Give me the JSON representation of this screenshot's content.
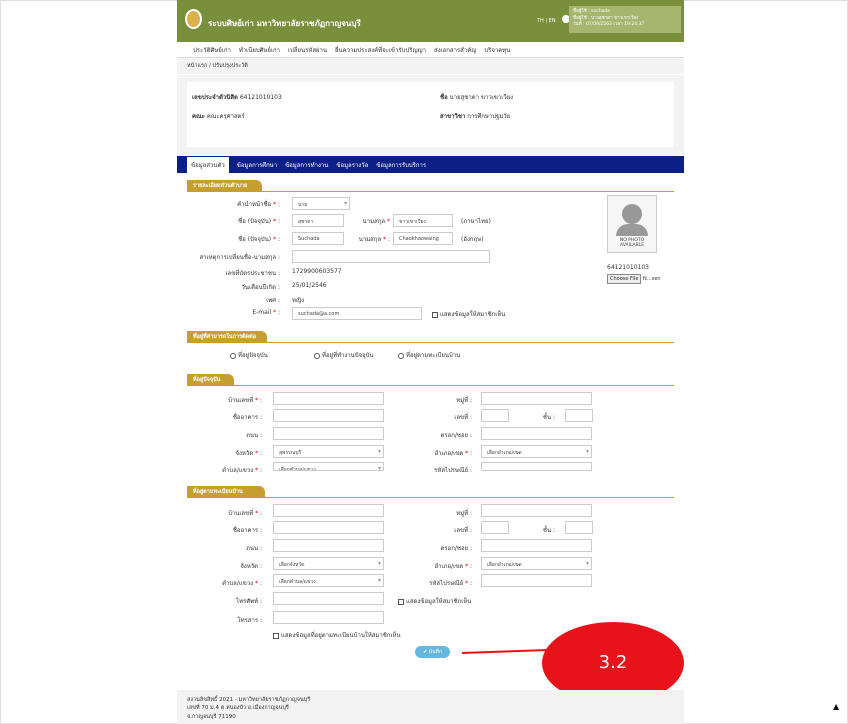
{
  "header": {
    "site_name": "ระบบศิษย์เก่า มหาวิทยาลัยราชภัฏกาญจนบุรี",
    "lang": "TH | EN",
    "user_line1": "ชื่อผู้ใช้ : suchada",
    "user_line2": "ชื่อผู้ใช้ : นางสุชาดา ขาวเขาเวียง",
    "user_line3": "วันที่ : 07/09/2563 เวลา 19:24:37"
  },
  "nav": [
    "ประวัติศิษย์เก่า",
    "ทำเนียบศิษย์เก่า",
    "เปลี่ยนรหัสผ่าน",
    "ยื่นความประสงค์ที่จะเข้ารับปริญญา",
    "ส่งเอกสารสำคัญ",
    "บริจาคทุน"
  ],
  "breadcrumb": "หน้าแรก / ปรับปรุงประวัติ",
  "info": {
    "student_id_label": "เลขประจำตัวนิสิต",
    "student_id": "64121010103",
    "name_label": "ชื่อ",
    "name": "นายสุชาดา ขาวเขาเวียง",
    "faculty_label": "คณะ",
    "faculty": "คณะครุศาสตร์",
    "major_label": "สาขาวิชา",
    "major": "การศึกษาปฐมวัย"
  },
  "tabs": [
    "ข้อมูลส่วนตัว",
    "ข้อมูลการศึกษา",
    "ข้อมูลการทำงาน",
    "ข้อมูลรางวัล",
    "ข้อมูลการรับบริการ"
  ],
  "personal": {
    "section": "รายละเอียดส่วนตัวบาย",
    "title_label": "คำนำหน้าชื่อ",
    "title_value": "นาย",
    "fname_th_label": "ชื่อ (ปัจจุบัน)",
    "fname_th": "สุชาดา",
    "lname_th_label": "นามสกุล",
    "lname_th": "ขาวเขาเวียง",
    "th_note": "(ภาษาไทย)",
    "fname_en_label": "ชื่อ (ปัจจุบัน)",
    "fname_en": "Suchada",
    "lname_en_label": "นามสกุล",
    "lname_en": "Chaokhaowaing",
    "en_note": "(อังกฤษ)",
    "reason_label": "สาเหตุการเปลี่ยนชื่อ-นามสกุล :",
    "idcard_label": "เลขที่บัตรประชาชน :",
    "idcard": "1729900603577",
    "dob_label": "วันเดือนปีเกิด :",
    "dob": "25/01/2546",
    "sex_label": "เพศ :",
    "sex": "หญิง",
    "email_label": "E-mail",
    "email": "suchada@a.com",
    "show_label": "แสดงข้อมูลให้สมาชิกเห็น",
    "photo_text": "NO PHOTO AVAILABLE",
    "photo_id": "64121010103",
    "choose_file": "Choose File",
    "file_name": "N…sen"
  },
  "contact": {
    "section": "ที่อยู่ที่สามารถในการติดต่อ",
    "options": [
      "ที่อยู่ปัจจุบัน",
      "ที่อยู่ที่ทำงานปัจจุบัน",
      "ที่อยู่ตามทะเบียนบ้าน"
    ]
  },
  "current": {
    "section": "ที่อยู่ปัจจุบัน",
    "house": "บ้านเลขที่",
    "moo": "หมู่ที่ :",
    "building": "ชื่ออาคาร :",
    "no": "เลขที่ :",
    "floor": "ชั้น :",
    "road": "ถนน :",
    "soi": "ตรอก/ซอย :",
    "province": "จังหวัด",
    "province_val": "สุพรรณบุรี",
    "district": "อำเภอ/เขต",
    "district_val": "เลือกอำเภอ/เขต",
    "subdistrict": "ตำบล/แขวง",
    "subdistrict_val": "เลือกตำบล/แขวง",
    "zip": "รหัสไปรษณีย์ :"
  },
  "registered": {
    "section": "ที่อยู่ตามทะเบียนบ้าน",
    "house": "บ้านเลขที่",
    "moo": "หมู่ที่ :",
    "building": "ชื่ออาคาร :",
    "no": "เลขที่ :",
    "floor": "ชั้น :",
    "road": "ถนน :",
    "soi": "ตรอก/ซอย :",
    "province": "จังหวัด :",
    "province_val": "เลือกจังหวัด",
    "district": "อำเภอ/เขต",
    "district_val": "เลือกอำเภอ/เขต",
    "subdistrict": "ตำบล/แขวง",
    "subdistrict_val": "เลือกตำบล/แขวง",
    "zip": "รหัสไปรษณีย์",
    "phone": "โทรศัพท์ :",
    "phone_show": "แสดงข้อมูลให้สมาชิกเห็น",
    "fax": "โทรสาร :",
    "show_reg": "แสดงข้อมูลที่อยู่ตามทะเบียนบ้านให้สมาชิกเห็น"
  },
  "save": "✔ บันทึก",
  "annotation": "3.2",
  "footer": {
    "line1": "สงวนลิขสิทธิ์ 2021 - มหาวิทยาลัยราชภัฏกาญจนบุรี",
    "line2": "เลขที่ 70 ม.4 ต.หนองบัว อ.เมืองกาญจนบุรี",
    "line3": "จ.กาญจนบุรี 71190"
  }
}
